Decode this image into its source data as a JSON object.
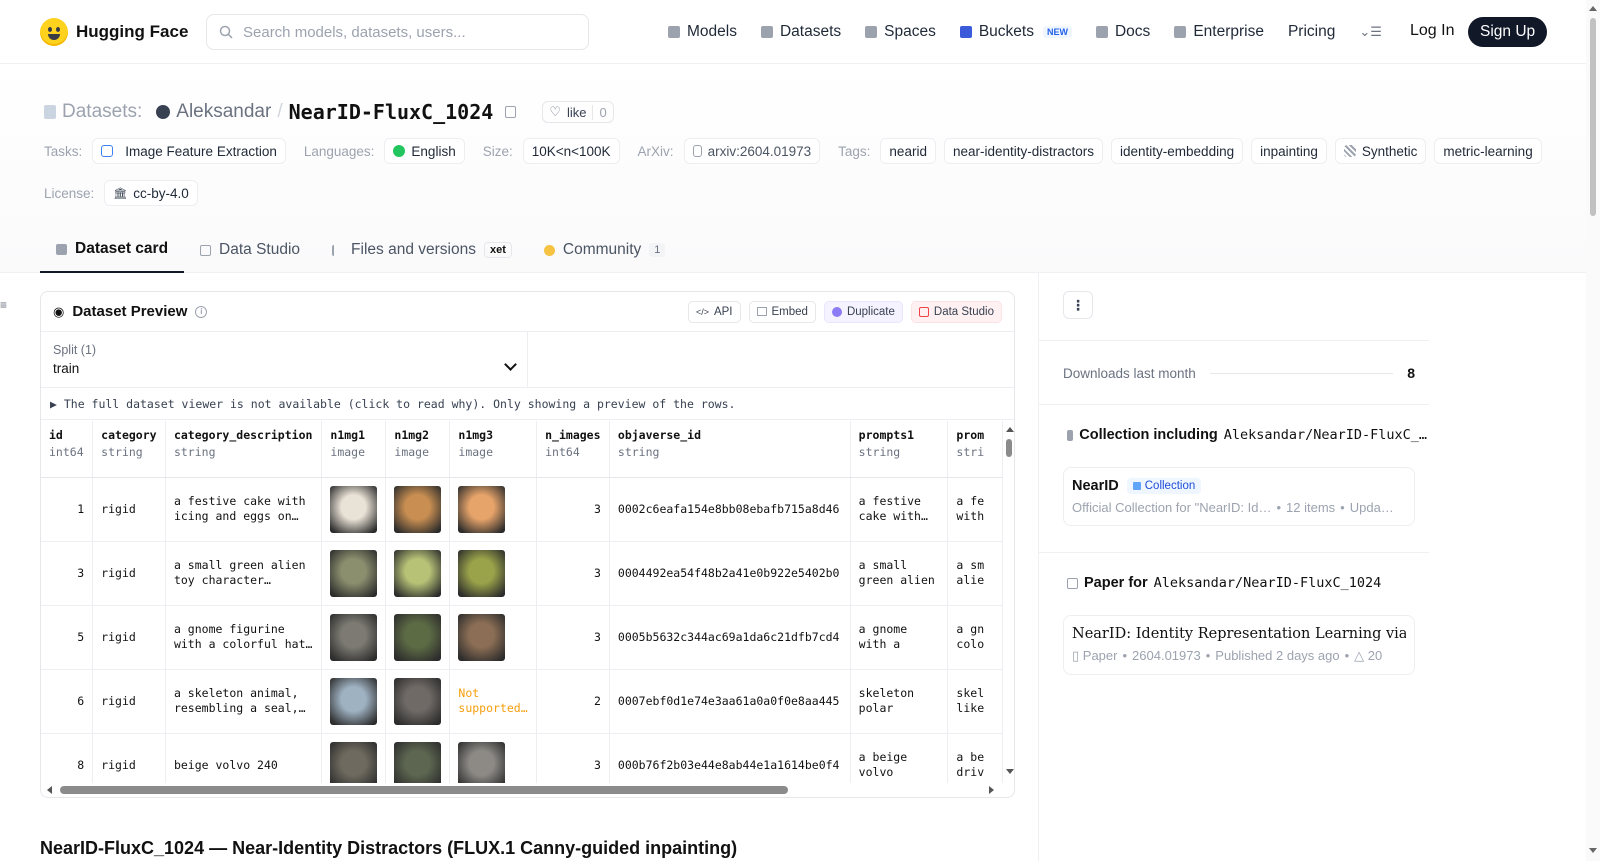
{
  "nav": {
    "brand": "Hugging Face",
    "search_placeholder": "Search models, datasets, users...",
    "links": [
      {
        "label": "Models",
        "icon": "cube-icon"
      },
      {
        "label": "Datasets",
        "icon": "database-icon"
      },
      {
        "label": "Spaces",
        "icon": "grid-icon"
      },
      {
        "label": "Buckets",
        "icon": "bucket-icon",
        "badge": "NEW"
      },
      {
        "label": "Docs",
        "icon": "book-icon"
      },
      {
        "label": "Enterprise",
        "icon": "enterprise-icon"
      },
      {
        "label": "Pricing"
      }
    ],
    "login": "Log In",
    "signup": "Sign Up"
  },
  "header": {
    "section_label": "Datasets:",
    "owner": "Aleksandar",
    "separator": "/",
    "name": "NearID-FluxC_1024",
    "like_label": "like",
    "like_count": "0",
    "tags": {
      "tasks_label": "Tasks:",
      "task": "Image Feature Extraction",
      "languages_label": "Languages:",
      "language": "English",
      "size_label": "Size:",
      "size": "10K<n<100K",
      "arxiv_label": "ArXiv:",
      "arxiv": "arxiv:2604.01973",
      "tags_label": "Tags:",
      "tag_list": [
        "nearid",
        "near-identity-distractors",
        "identity-embedding",
        "inpainting",
        "Synthetic",
        "metric-learning"
      ],
      "license_label": "License:",
      "license": "cc-by-4.0"
    },
    "tabs": [
      {
        "label": "Dataset card",
        "active": true
      },
      {
        "label": "Data Studio"
      },
      {
        "label": "Files and versions",
        "badge": "xet"
      },
      {
        "label": "Community",
        "count": "1"
      }
    ]
  },
  "preview": {
    "title": "Dataset Preview",
    "buttons": {
      "api": "API",
      "embed": "Embed",
      "duplicate": "Duplicate",
      "data_studio": "Data Studio"
    },
    "split_label": "Split (1)",
    "split_value": "train",
    "notice": "▶ The full dataset viewer is not available (click to read why). Only showing a preview of the rows.",
    "columns": [
      {
        "name": "id",
        "type": "int64"
      },
      {
        "name": "category",
        "type": "string"
      },
      {
        "name": "category_description",
        "type": "string"
      },
      {
        "name": "n1mg1",
        "type": "image"
      },
      {
        "name": "n1mg2",
        "type": "image"
      },
      {
        "name": "n1mg3",
        "type": "image"
      },
      {
        "name": "n_images",
        "type": "int64"
      },
      {
        "name": "objaverse_id",
        "type": "string"
      },
      {
        "name": "prompts1",
        "type": "string"
      },
      {
        "name": "prom",
        "type": "stri"
      }
    ],
    "not_supported": "Not supported…",
    "rows": [
      {
        "id": "1",
        "category": "rigid",
        "desc": "a festive cake with icing and eggs on…",
        "n_images": "3",
        "objaverse_id": "0002c6eafa154e8bb08ebafb715a8d46",
        "p1": "a festive cake with…",
        "p2": "a fe with",
        "imgs": [
          "#e9e2d6",
          "#c98f52",
          "#e7a46a"
        ]
      },
      {
        "id": "3",
        "category": "rigid",
        "desc": "a small green alien toy character…",
        "n_images": "3",
        "objaverse_id": "0004492ea54f48b2a41e0b922e5402b0",
        "p1": "a small green alien toy…",
        "p2": "a sm alie",
        "imgs": [
          "#8b8f6e",
          "#b7c277",
          "#9aa34a"
        ]
      },
      {
        "id": "5",
        "category": "rigid",
        "desc": "a gnome figurine with a colorful hat…",
        "n_images": "3",
        "objaverse_id": "0005b5632c344ac69a1da6c21dfb7cd4",
        "p1": "a gnome with a colorful…",
        "p2": "a gn colo",
        "imgs": [
          "#7c7a72",
          "#5d6b45",
          "#8b6e55"
        ]
      },
      {
        "id": "6",
        "category": "rigid",
        "desc": "a skeleton animal, resembling a seal,…",
        "n_images": "2",
        "objaverse_id": "0007ebf0d1e74e3aa61a0a0f0e8aa445",
        "p1": "skeleton polar bear-…",
        "p2": "skel like",
        "imgs": [
          "#9fb2c2",
          "#6f6a66",
          null
        ]
      },
      {
        "id": "8",
        "category": "rigid",
        "desc": "beige volvo 240",
        "n_images": "3",
        "objaverse_id": "000b76f2b03e44e8ab44e1a1614be0f4",
        "p1": "a beige volvo parked on a…",
        "p2": "a be driv",
        "imgs": [
          "#6e6a5f",
          "#5c6650",
          "#8d8a86"
        ]
      }
    ]
  },
  "bottom_heading": "NearID-FluxC_1024 — Near-Identity Distractors (FLUX.1 Canny-guided inpainting)",
  "sidebar": {
    "downloads_label": "Downloads last month",
    "downloads_value": "8",
    "collection_title": "Collection including",
    "collection_repo": "Aleksandar/NearID-FluxC_…",
    "collection_name": "NearID",
    "collection_badge": "Collection",
    "collection_desc": "Official Collection for \"NearID: Id…",
    "collection_items": "12 items",
    "collection_updated": "Upda…",
    "paper_title": "Paper for",
    "paper_repo": "Aleksandar/NearID-FluxC_1024",
    "paper_name": "NearID: Identity Representation Learning via Near…",
    "paper_label": "Paper",
    "paper_id": "2604.01973",
    "paper_published": "Published 2 days ago",
    "paper_upvotes": "20"
  },
  "colors": {
    "accent": "#111827",
    "brand": "#ffd21e",
    "not_supported": "#f59e0b"
  }
}
